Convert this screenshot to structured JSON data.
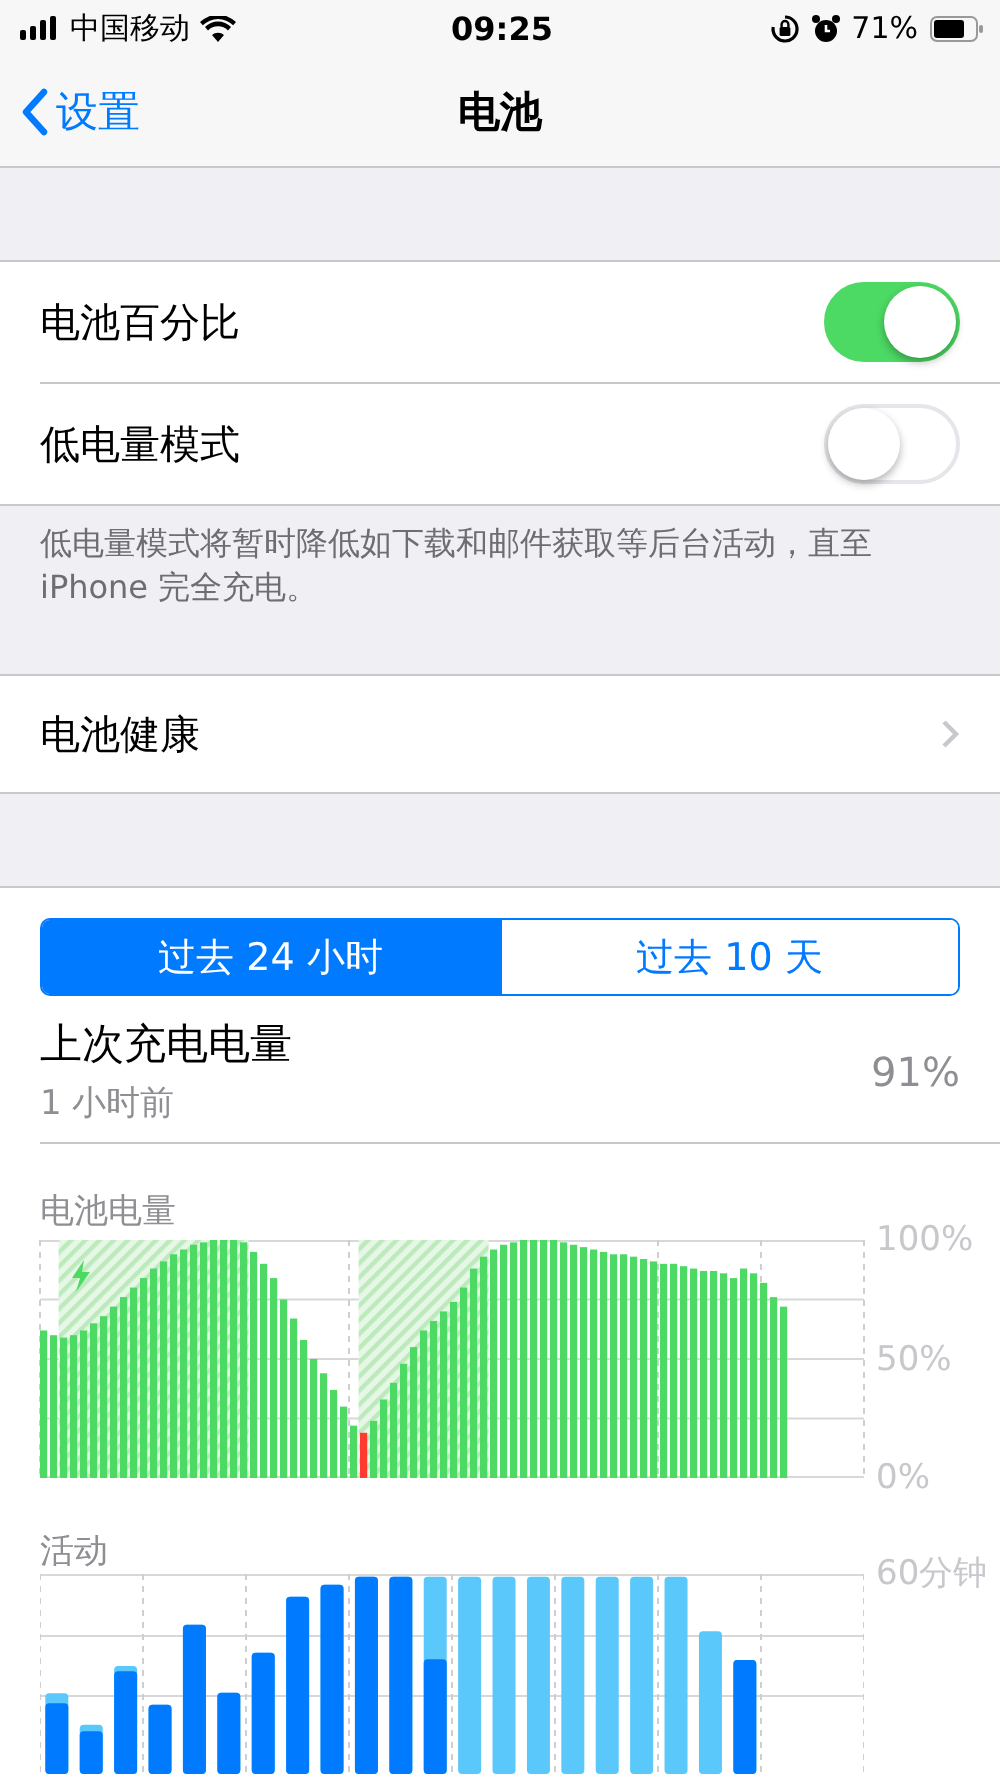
{
  "status_bar": {
    "carrier": "中国移动",
    "time": "09:25",
    "battery_percent": "71%"
  },
  "nav": {
    "back": "设置",
    "title": "电池"
  },
  "toggles": [
    {
      "label": "电池百分比",
      "on": true
    },
    {
      "label": "低电量模式",
      "on": false
    }
  ],
  "toggle_footer": "低电量模式将暂时降低如下载和邮件获取等后台活动，直至 iPhone 完全充电。",
  "health": {
    "label": "电池健康"
  },
  "segments": [
    {
      "label": "过去 24 小时",
      "selected": true
    },
    {
      "label": "过去 10 天",
      "selected": false
    }
  ],
  "last_charge": {
    "label": "上次充电电量",
    "time": "1 小时前",
    "value": "91%"
  },
  "battery_chart": {
    "title": "电池电量",
    "chart_data": {
      "type": "bar",
      "stacked": true,
      "ylim": [
        0,
        100
      ],
      "yticks": [
        {
          "value": 0,
          "label": "0%"
        },
        {
          "value": 50,
          "label": "50%"
        },
        {
          "value": 100,
          "label": "100%"
        }
      ],
      "series": [
        {
          "color": "#4cd964",
          "values": [
            62,
            60,
            59,
            60,
            62,
            65,
            68,
            72,
            76,
            80,
            84,
            88,
            91,
            94,
            96,
            98,
            99,
            100,
            100,
            100,
            99,
            95,
            90,
            84,
            75,
            67,
            58,
            50,
            44,
            37,
            30,
            22,
            null,
            24,
            33,
            40,
            48,
            55,
            62,
            66,
            70,
            74,
            80,
            88,
            93,
            96,
            98,
            99,
            100,
            100,
            100,
            100,
            99,
            98,
            97,
            96,
            95,
            94,
            94,
            93,
            92,
            91,
            90,
            90,
            89,
            88,
            87,
            87,
            86,
            84,
            88,
            86,
            82,
            76,
            72
          ]
        },
        {
          "color": "#ff3b30",
          "values": [
            null,
            null,
            null,
            null,
            null,
            null,
            null,
            null,
            null,
            null,
            null,
            null,
            null,
            null,
            null,
            null,
            null,
            null,
            null,
            null,
            null,
            null,
            null,
            null,
            null,
            null,
            null,
            null,
            null,
            null,
            null,
            null,
            19,
            null,
            null,
            null,
            null,
            null,
            null,
            null,
            null,
            null,
            null,
            null,
            null,
            null,
            null,
            null,
            null,
            null,
            null,
            null,
            null,
            null,
            null,
            null,
            null,
            null,
            null,
            null,
            null,
            null,
            null,
            null,
            null,
            null,
            null,
            null,
            null,
            null,
            null,
            null,
            null,
            null,
            null
          ]
        }
      ]
    }
  },
  "activity": {
    "title": "活动",
    "axis_label": "60分钟"
  }
}
